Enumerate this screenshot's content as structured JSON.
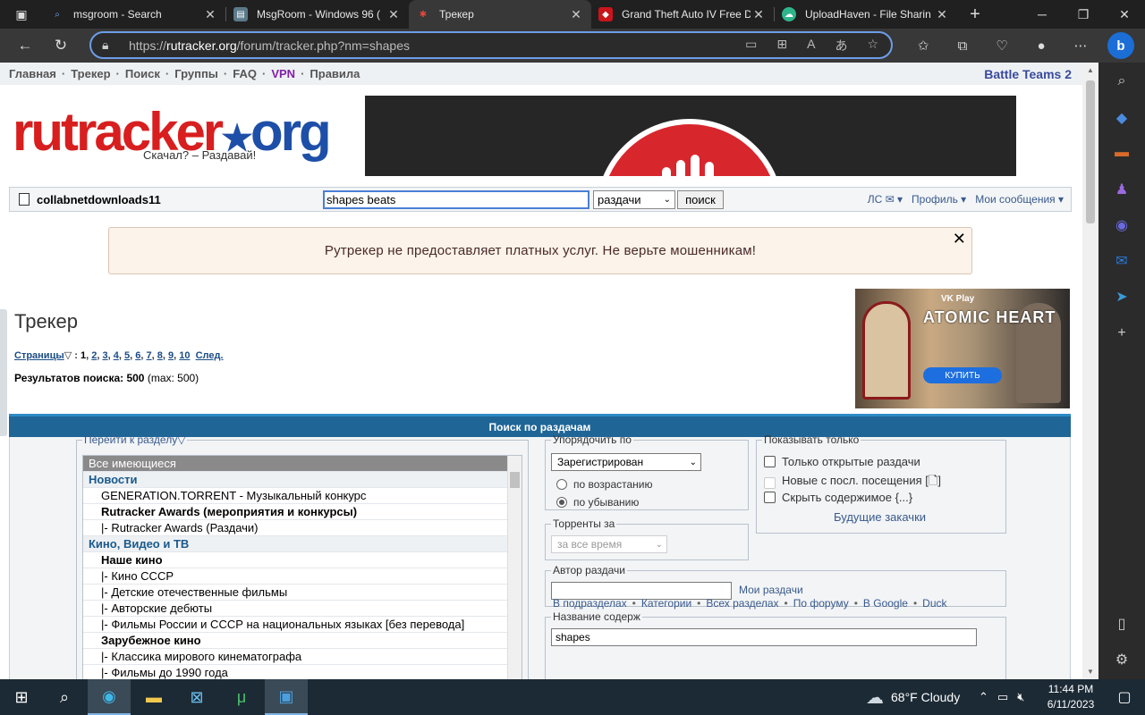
{
  "tabs": [
    {
      "title": "msgroom - Search",
      "icon": "search-icon",
      "active": false
    },
    {
      "title": "MsgRoom - Windows 96 (",
      "icon": "msgroom-icon",
      "active": false
    },
    {
      "title": "Трекер",
      "icon": "rutracker-icon",
      "active": true
    },
    {
      "title": "Grand Theft Auto IV Free D",
      "icon": "gta-icon",
      "active": false
    },
    {
      "title": "UploadHaven - File Sharin",
      "icon": "uploadhaven-icon",
      "active": false
    }
  ],
  "address": {
    "prefix": "https://",
    "host": "rutracker.org",
    "path": "/forum/tracker.php?nm=shapes"
  },
  "nav": {
    "items": [
      "Главная",
      "Трекер",
      "Поиск",
      "Группы",
      "FAQ",
      "VPN",
      "Правила"
    ],
    "battle": "Battle Teams 2"
  },
  "logo": {
    "text_ru": "rutracker",
    "text_org": "org",
    "tagline": "Скачал? – Раздавай!"
  },
  "userbar": {
    "username": "collabnetdownloads11",
    "search_value": "shapes beats",
    "search_scope": "раздачи",
    "search_button": "поиск",
    "links": [
      "ЛС ✉ ▾",
      "Профиль ▾",
      "Мои сообщения ▾"
    ]
  },
  "warning": {
    "text": "Рутрекер не предоставляет платных услуг. Не верьте мошенникам!",
    "close": "✕"
  },
  "main": {
    "title": "Трекер",
    "pages_label": "Страницы",
    "pages": [
      "1",
      "2",
      "3",
      "4",
      "5",
      "6",
      "7",
      "8",
      "9",
      "10"
    ],
    "next": "След.",
    "results_label": "Результатов поиска: 500",
    "results_max": "(max: 500)"
  },
  "ad": {
    "brand": "VK Play",
    "title": "ATOMIC HEART",
    "button": "КУПИТЬ"
  },
  "search_panel": {
    "header": "Поиск по раздачам",
    "forum_legend": "Перейти к разделу",
    "forum_list": [
      {
        "text": "Все имеющиеся",
        "kind": "sel"
      },
      {
        "text": "Новости",
        "kind": "cat"
      },
      {
        "text": "GENERATION.TORRENT - Музыкальный конкурс",
        "kind": "sub"
      },
      {
        "text": "Rutracker Awards (мероприятия и конкурсы)",
        "kind": "bold"
      },
      {
        "text": "|- Rutracker Awards (Раздачи)",
        "kind": "sub"
      },
      {
        "text": "Кино, Видео и ТВ",
        "kind": "cat"
      },
      {
        "text": "Наше кино",
        "kind": "bold"
      },
      {
        "text": "|- Кино СССР",
        "kind": "sub"
      },
      {
        "text": "|- Детские отечественные фильмы",
        "kind": "sub"
      },
      {
        "text": "|- Авторские дебюты",
        "kind": "sub"
      },
      {
        "text": "|- Фильмы России и СССР на национальных языках [без перевода]",
        "kind": "sub"
      },
      {
        "text": "Зарубежное кино",
        "kind": "bold"
      },
      {
        "text": "|- Классика мирового кинематографа",
        "kind": "sub"
      },
      {
        "text": "|- Фильмы до 1990 года",
        "kind": "sub"
      }
    ],
    "order_legend": "Упорядочить по",
    "order_value": "Зарегистрирован",
    "asc": "по возрастанию",
    "desc": "по убыванию",
    "period_legend": "Торренты за",
    "period_value": "за все время",
    "show_legend": "Показывать только",
    "show_opts": [
      "Только открытые раздачи",
      "Новые с посл. посещения [🗋]",
      "Скрыть содержимое {...}"
    ],
    "future": "Будущие закачки",
    "author_legend": "Автор раздачи",
    "author_value": "",
    "my_releases": "Мои раздачи",
    "name_legend": "Название содерж",
    "name_value": "shapes",
    "name_links": [
      "В подразделах",
      "Категории",
      "Всех разделах",
      "По форуму",
      "В Google",
      "Duck"
    ]
  },
  "taskbar": {
    "weather": "68°F  Cloudy",
    "time": "11:44 PM",
    "date": "6/11/2023"
  }
}
